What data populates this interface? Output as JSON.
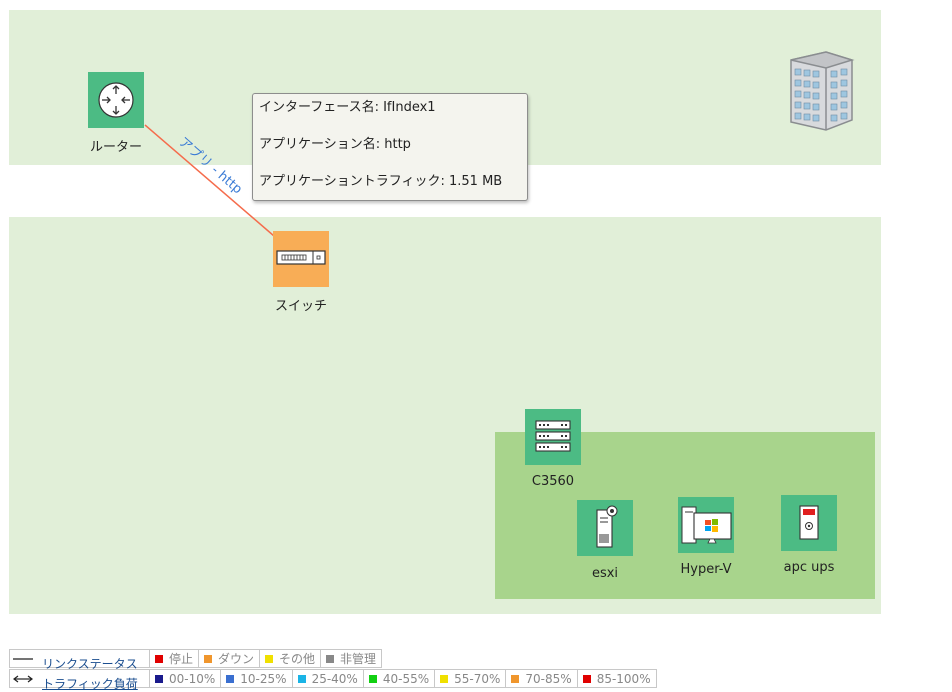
{
  "tooltip": {
    "interface_line": "インターフェース名: IfIndex1",
    "application_line": "アプリケーション名: http",
    "traffic_line": "アプリケーショントラフィック: 1.51 MB"
  },
  "link": {
    "label": "アプリ - http",
    "color": "#f56c4c",
    "label_color": "#3a7bd5"
  },
  "nodes": {
    "router": {
      "label": "ルーター",
      "icon": "router-icon"
    },
    "switch": {
      "label": "スイッチ",
      "icon": "switch-icon"
    },
    "c3560": {
      "label": "C3560",
      "icon": "l3-switch-icon"
    },
    "esxi": {
      "label": "esxi",
      "icon": "server-icon"
    },
    "hyperv": {
      "label": "Hyper-V",
      "icon": "windows-workstation-icon"
    },
    "apcups": {
      "label": "apc ups",
      "icon": "ups-icon"
    }
  },
  "legend": {
    "link_status": {
      "title": "リンクステータス",
      "items": [
        {
          "label": "停止",
          "color": "#e00000"
        },
        {
          "label": "ダウン",
          "color": "#f0962d"
        },
        {
          "label": "その他",
          "color": "#f0e000"
        },
        {
          "label": "非管理",
          "color": "#888888"
        }
      ]
    },
    "traffic_load": {
      "title": "トラフィック負荷",
      "items": [
        {
          "label": "00-10%",
          "color": "#1a1a8c"
        },
        {
          "label": "10-25%",
          "color": "#3a6fd0"
        },
        {
          "label": "25-40%",
          "color": "#1ab4e6"
        },
        {
          "label": "40-55%",
          "color": "#12d012"
        },
        {
          "label": "55-70%",
          "color": "#f0e000"
        },
        {
          "label": "70-85%",
          "color": "#f0962d"
        },
        {
          "label": "85-100%",
          "color": "#e00000"
        }
      ]
    }
  }
}
